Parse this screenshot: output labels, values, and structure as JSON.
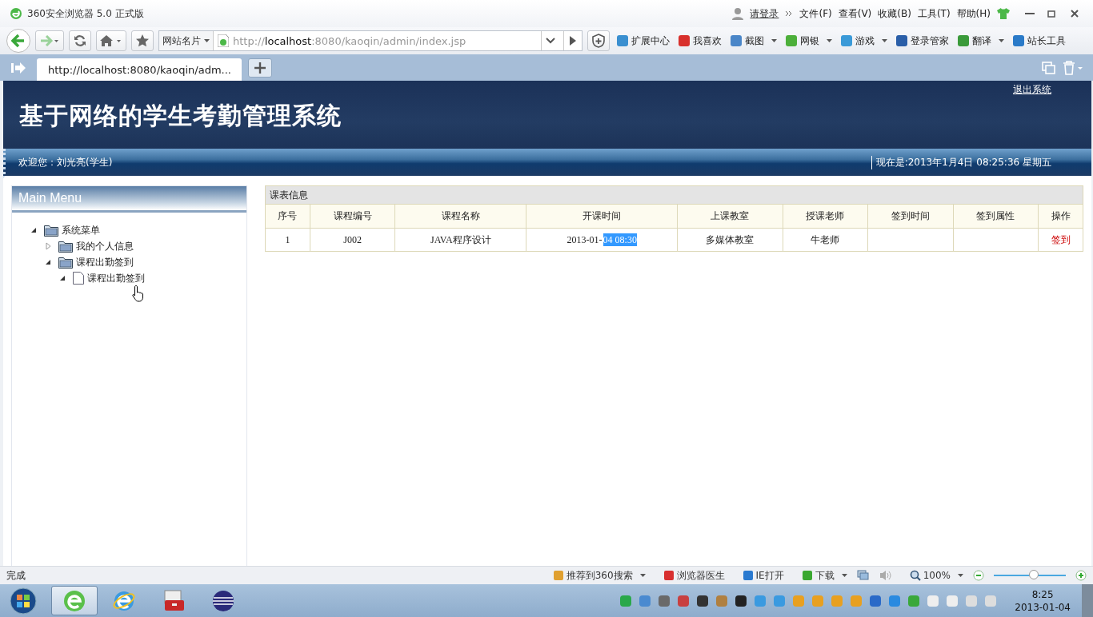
{
  "browser": {
    "title": "360安全浏览器 5.0 正式版",
    "login": "请登录",
    "menu": [
      "文件(F)",
      "查看(V)",
      "收藏(B)",
      "工具(T)",
      "帮助(H)"
    ],
    "site_card": "网站名片",
    "url": {
      "scheme": "http://",
      "host": "localhost",
      "rest": ":8080/kaoqin/admin/index.jsp"
    },
    "toolbar": [
      {
        "label": "扩展中心",
        "has_menu": false
      },
      {
        "label": "我喜欢",
        "has_menu": false
      },
      {
        "label": "截图",
        "has_menu": true
      },
      {
        "label": "网银",
        "has_menu": true
      },
      {
        "label": "游戏",
        "has_menu": true
      },
      {
        "label": "登录管家",
        "has_menu": false
      },
      {
        "label": "翻译",
        "has_menu": true
      },
      {
        "label": "站长工具",
        "has_menu": false
      }
    ],
    "tabs": [
      {
        "title": "http://localhost:8080/kaoqin/adm...",
        "selected": true
      }
    ]
  },
  "page": {
    "title": "基于网络的学生考勤管理系统",
    "logout": "退出系统",
    "welcome": "欢迎您：刘光亮(学生)",
    "now": "现在是:2013年1月4日  08:25:36 星期五",
    "menu": {
      "title": "Main Menu",
      "tree": [
        {
          "label": "系统菜单",
          "kind": "folder",
          "expanded": true,
          "children": [
            {
              "label": "我的个人信息",
              "kind": "folder",
              "expanded": false
            },
            {
              "label": "课程出勤签到",
              "kind": "folder",
              "expanded": true,
              "children": [
                {
                  "label": "课程出勤签到",
                  "kind": "file",
                  "expanded": true
                }
              ]
            }
          ]
        }
      ]
    },
    "table": {
      "caption": "课表信息",
      "columns": [
        "序号",
        "课程编号",
        "课程名称",
        "开课时间",
        "上课教室",
        "授课老师",
        "签到时间",
        "签到属性",
        "操作"
      ],
      "rows": [
        {
          "cells": [
            {
              "text": "1"
            },
            {
              "text": "J002"
            },
            {
              "text": "JAVA程序设计"
            },
            {
              "text": "2013-01-",
              "selected_text": "04 08:30"
            },
            {
              "text": "多媒体教室"
            },
            {
              "text": "牛老师"
            },
            {},
            {},
            {
              "text": "签到",
              "kind": "link"
            }
          ]
        }
      ]
    }
  },
  "status_bar": {
    "text": "完成",
    "items": [
      {
        "label": "推荐到360搜索",
        "has_menu": true
      },
      {
        "label": "浏览器医生",
        "has_menu": false
      },
      {
        "label": "IE打开",
        "has_menu": false
      },
      {
        "label": "下载",
        "has_menu": true
      }
    ],
    "zoom": "100%",
    "zoom_level": {
      "level": 0.55
    }
  },
  "taskbar": {
    "apps": [
      {
        "kind": "green-browser",
        "selected": true
      },
      {
        "kind": "blue-browser",
        "selected": false
      },
      {
        "kind": "toolbox",
        "selected": false
      },
      {
        "kind": "sphere",
        "selected": false
      }
    ],
    "time": "8:25",
    "date": "2013-01-04"
  }
}
